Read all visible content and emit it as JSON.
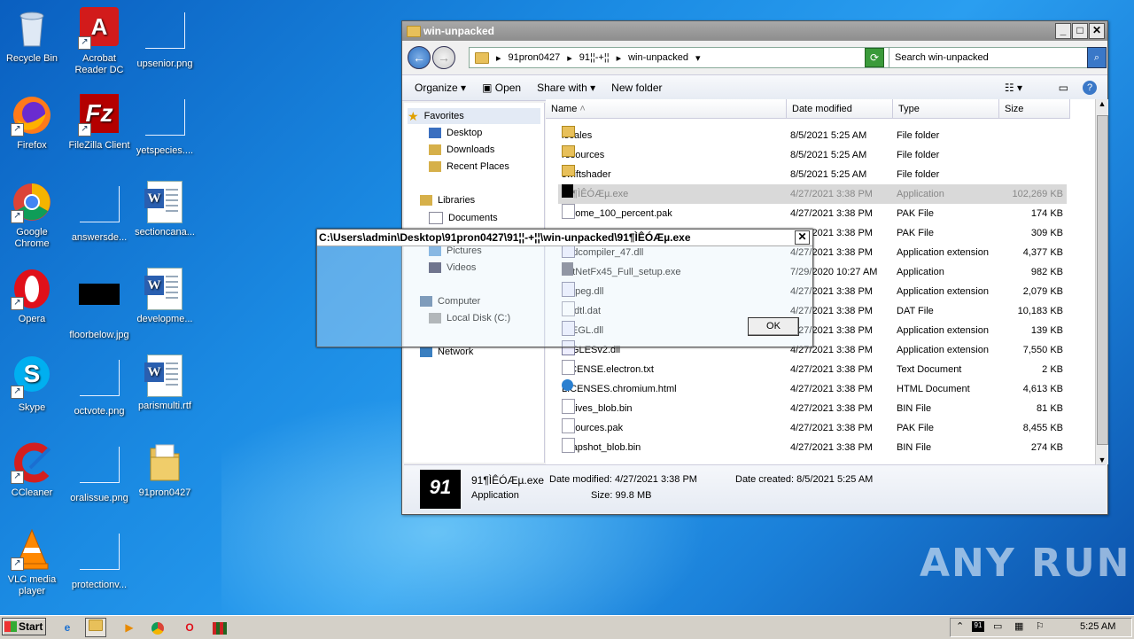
{
  "desktop": {
    "icons": [
      {
        "label": "Recycle Bin"
      },
      {
        "label": "Acrobat Reader DC"
      },
      {
        "label": "upsenior.png"
      },
      {
        "label": "Firefox"
      },
      {
        "label": "FileZilla Client"
      },
      {
        "label": "yetspecies...."
      },
      {
        "label": "Google Chrome"
      },
      {
        "label": "answersde..."
      },
      {
        "label": "sectioncana..."
      },
      {
        "label": "Opera"
      },
      {
        "label": "floorbelow.jpg"
      },
      {
        "label": "developme..."
      },
      {
        "label": "Skype"
      },
      {
        "label": "octvote.png"
      },
      {
        "label": "parismulti.rtf"
      },
      {
        "label": "CCleaner"
      },
      {
        "label": "oralissue.png"
      },
      {
        "label": "91pron0427"
      },
      {
        "label": "VLC media player"
      },
      {
        "label": "protectionv..."
      }
    ]
  },
  "explorer": {
    "title": "win-unpacked",
    "breadcrumb": [
      "91pron0427",
      "91¦¦-+¦¦",
      "win-unpacked"
    ],
    "search_placeholder": "Search win-unpacked",
    "toolbar": {
      "organize": "Organize",
      "open": "Open",
      "share_with": "Share with",
      "new_folder": "New folder"
    },
    "nav": {
      "favorites": "Favorites",
      "desktop": "Desktop",
      "downloads": "Downloads",
      "recent_places": "Recent Places",
      "libraries": "Libraries",
      "documents": "Documents",
      "pictures": "Pictures",
      "videos": "Videos",
      "computer": "Computer",
      "local_disk": "Local Disk (C:)",
      "network": "Network"
    },
    "columns": {
      "name": "Name",
      "date_modified": "Date modified",
      "type": "Type",
      "size": "Size"
    },
    "files": [
      {
        "name": "locales",
        "date": "8/5/2021 5:25 AM",
        "type": "File folder",
        "size": "",
        "icon": "folder"
      },
      {
        "name": "resources",
        "date": "8/5/2021 5:25 AM",
        "type": "File folder",
        "size": "",
        "icon": "folder"
      },
      {
        "name": "swiftshader",
        "date": "8/5/2021 5:25 AM",
        "type": "File folder",
        "size": "",
        "icon": "folder"
      },
      {
        "name": "91¶ÌÊÓÆµ.exe",
        "date": "4/27/2021 3:38 PM",
        "type": "Application",
        "size": "102,269 KB",
        "icon": "app"
      },
      {
        "name": "chrome_100_percent.pak",
        "date": "4/27/2021 3:38 PM",
        "type": "PAK File",
        "size": "174 KB",
        "icon": "file"
      },
      {
        "name": "",
        "date": "4/27/2021 3:38 PM",
        "type": "PAK File",
        "size": "309 KB",
        "icon": "file"
      },
      {
        "name": "d3dcompiler_47.dll",
        "date": "4/27/2021 3:38 PM",
        "type": "Application extension",
        "size": "4,377 KB",
        "icon": "dll"
      },
      {
        "name": "dotNetFx45_Full_setup.exe",
        "date": "7/29/2020 10:27 AM",
        "type": "Application",
        "size": "982 KB",
        "icon": "setup"
      },
      {
        "name": "ffmpeg.dll",
        "date": "4/27/2021 3:38 PM",
        "type": "Application extension",
        "size": "2,079 KB",
        "icon": "dll"
      },
      {
        "name": "icudtl.dat",
        "date": "4/27/2021 3:38 PM",
        "type": "DAT File",
        "size": "10,183 KB",
        "icon": "file"
      },
      {
        "name": "libEGL.dll",
        "date": "4/27/2021 3:38 PM",
        "type": "Application extension",
        "size": "139 KB",
        "icon": "dll"
      },
      {
        "name": "libGLESv2.dll",
        "date": "4/27/2021 3:38 PM",
        "type": "Application extension",
        "size": "7,550 KB",
        "icon": "dll"
      },
      {
        "name": "LICENSE.electron.txt",
        "date": "4/27/2021 3:38 PM",
        "type": "Text Document",
        "size": "2 KB",
        "icon": "file"
      },
      {
        "name": "LICENSES.chromium.html",
        "date": "4/27/2021 3:38 PM",
        "type": "HTML Document",
        "size": "4,613 KB",
        "icon": "html"
      },
      {
        "name": "natives_blob.bin",
        "date": "4/27/2021 3:38 PM",
        "type": "BIN File",
        "size": "81 KB",
        "icon": "file"
      },
      {
        "name": "resources.pak",
        "date": "4/27/2021 3:38 PM",
        "type": "PAK File",
        "size": "8,455 KB",
        "icon": "file"
      },
      {
        "name": "snapshot_blob.bin",
        "date": "4/27/2021 3:38 PM",
        "type": "BIN File",
        "size": "274 KB",
        "icon": "file"
      }
    ],
    "details": {
      "name": "91¶ÌÊÓÆµ.exe",
      "type": "Application",
      "date_modified": "Date modified: 4/27/2021 3:38 PM",
      "date_created": "Date created: 8/5/2021 5:25 AM",
      "size": "Size: 99.8 MB"
    }
  },
  "msgbox": {
    "title": "C:\\Users\\admin\\Desktop\\91pron0427\\91¦¦-+¦¦\\win-unpacked\\91¶ÌÊÓÆµ.exe",
    "ok": "OK"
  },
  "taskbar": {
    "start": "Start",
    "clock": "5:25 AM"
  },
  "watermark": "ANY RUN"
}
